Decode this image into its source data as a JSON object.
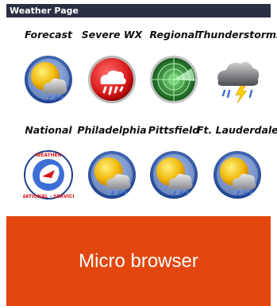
{
  "header": {
    "title": "Weather Page"
  },
  "tiles": [
    {
      "label": "Forecast",
      "icon": "sun-cloud-icon"
    },
    {
      "label": "Severe WX",
      "icon": "severe-weather-icon"
    },
    {
      "label": "Regional",
      "icon": "radar-icon"
    },
    {
      "label": "Thunderstorms",
      "icon": "thunderstorm-icon"
    },
    {
      "label": "National",
      "icon": "national-weather-service-logo"
    },
    {
      "label": "Philadelphia",
      "icon": "sun-cloud-icon"
    },
    {
      "label": "Pittsfield",
      "icon": "sun-cloud-icon"
    },
    {
      "label": "Ft. Lauderdale",
      "icon": "sun-cloud-icon"
    }
  ],
  "nws_logo_text": "NATIONAL WEATHER SERVICE",
  "footer": {
    "button_label": "Micro browser"
  },
  "colors": {
    "header_bg": "#2b2f44",
    "button_bg": "#e2470f"
  }
}
